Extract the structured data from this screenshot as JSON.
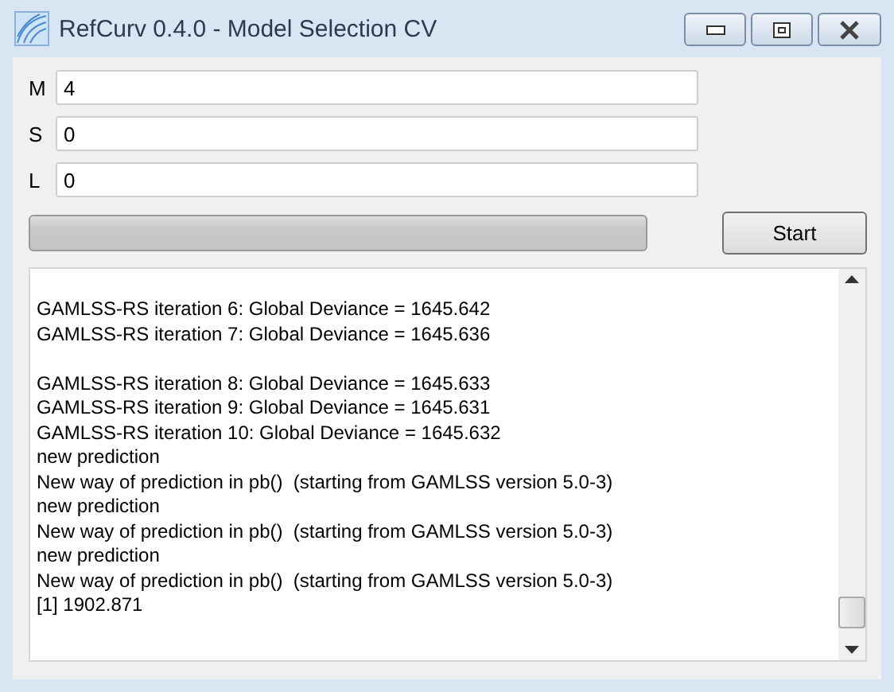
{
  "window": {
    "title": "RefCurv 0.4.0 - Model Selection CV"
  },
  "fields": [
    {
      "label": "M",
      "value": "4"
    },
    {
      "label": "S",
      "value": "0"
    },
    {
      "label": "L",
      "value": "0"
    }
  ],
  "progress": {
    "level": 0
  },
  "start_button": "Start",
  "log": {
    "blocks": [
      [
        "GAMLSS-RS iteration 6: Global Deviance = 1645.642",
        "GAMLSS-RS iteration 7: Global Deviance = 1645.636"
      ],
      [
        "GAMLSS-RS iteration 8: Global Deviance = 1645.633",
        "GAMLSS-RS iteration 9: Global Deviance = 1645.631",
        "GAMLSS-RS iteration 10: Global Deviance = 1645.632",
        "new prediction",
        "New way of prediction in pb()  (starting from GAMLSS version 5.0-3)",
        "new prediction",
        "New way of prediction in pb()  (starting from GAMLSS version 5.0-3)",
        "new prediction",
        "New way of prediction in pb()  (starting from GAMLSS version 5.0-3)",
        "[1] 1902.871"
      ]
    ]
  }
}
